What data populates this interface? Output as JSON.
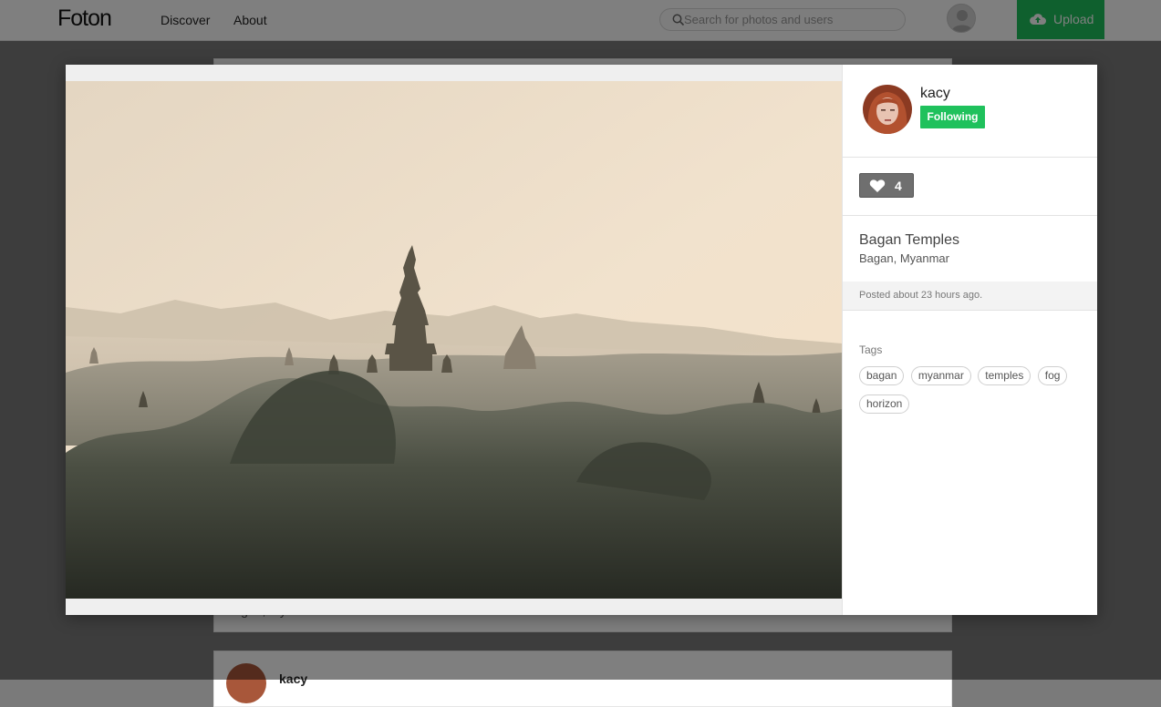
{
  "nav": {
    "logo": "Foton",
    "links": [
      "Discover",
      "About"
    ],
    "search_placeholder": "Search for photos and users",
    "upload_label": "Upload"
  },
  "background": {
    "card_location": "Bagan, Myanmar",
    "card_username": "kacy"
  },
  "modal": {
    "user": {
      "name": "kacy",
      "follow_label": "Following"
    },
    "likes": 4,
    "photo": {
      "title": "Bagan Temples",
      "location": "Bagan, Myanmar"
    },
    "posted": "Posted about 23 hours ago.",
    "tags_heading": "Tags",
    "tags": [
      "bagan",
      "myanmar",
      "temples",
      "fog",
      "horizon"
    ]
  },
  "colors": {
    "accent_green": "#1fc15c",
    "like_button_bg": "#6f6f6f"
  },
  "icons": {
    "search": "search-icon",
    "upload": "cloud-upload-icon",
    "like": "heart-icon",
    "avatar": "user-avatar-icon"
  }
}
